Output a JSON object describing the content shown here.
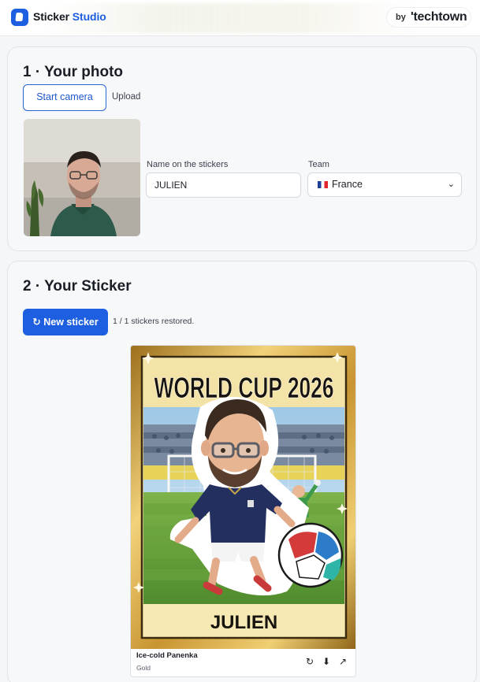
{
  "header": {
    "brand_part1": "Sticker",
    "brand_part2": "Studio",
    "by_label": "by",
    "partner": "'techtown"
  },
  "section1": {
    "title": "1 · Your photo",
    "start_camera_label": "Start camera",
    "upload_label": "Upload",
    "name_label": "Name on the stickers",
    "name_value": "JULIEN",
    "team_label": "Team",
    "team_value": "France"
  },
  "section2": {
    "title": "2 · Your Sticker",
    "new_sticker_label": "New sticker",
    "status": "1 / 1 stickers restored.",
    "sticker": {
      "headline": "WORLD CUP 2026",
      "player_name": "JULIEN",
      "caption": "Ice-cold Panenka",
      "tier": "Gold"
    }
  },
  "colors": {
    "accent": "#1d5fe0",
    "gold_frame": "#d7a83a",
    "jersey": "#23305f"
  }
}
